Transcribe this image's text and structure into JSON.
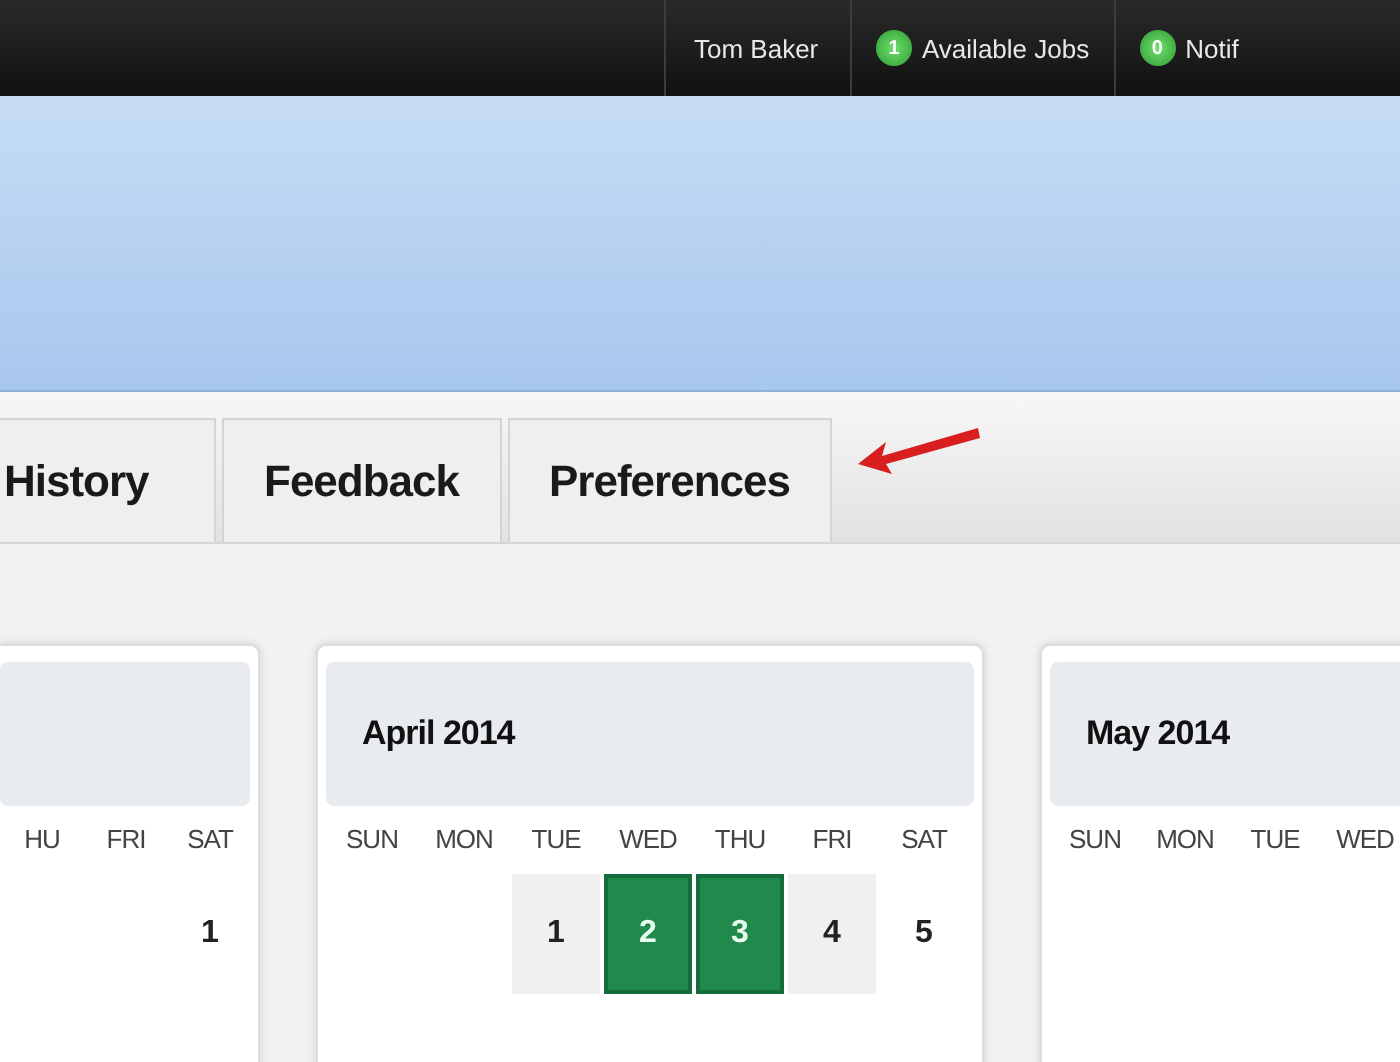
{
  "top_bar": {
    "user": "Tom Baker",
    "badges": [
      {
        "count": "1",
        "label": "Available Jobs"
      },
      {
        "count": "0",
        "label": "Notif"
      }
    ]
  },
  "tabs": [
    {
      "label": "History",
      "selected": false
    },
    {
      "label": "Feedback",
      "selected": false
    },
    {
      "label": "Preferences",
      "selected": false
    }
  ],
  "calendars": [
    {
      "weekdays": [
        "HU",
        "FRI",
        "SAT"
      ],
      "dates": [
        {
          "kind": "empty"
        },
        {
          "kind": "empty"
        },
        {
          "kind": "day",
          "label": "1",
          "available": false,
          "selected": false
        }
      ]
    },
    {
      "title": "April 2014",
      "weekdays": [
        "SUN",
        "MON",
        "TUE",
        "WED",
        "THU",
        "FRI",
        "SAT"
      ],
      "dates": [
        {
          "kind": "empty"
        },
        {
          "kind": "empty"
        },
        {
          "kind": "day",
          "label": "1",
          "available": true,
          "selected": false
        },
        {
          "kind": "day",
          "label": "2",
          "available": true,
          "selected": true
        },
        {
          "kind": "day",
          "label": "3",
          "available": true,
          "selected": true
        },
        {
          "kind": "day",
          "label": "4",
          "available": true,
          "selected": false
        },
        {
          "kind": "day",
          "label": "5",
          "available": false,
          "selected": false
        }
      ]
    },
    {
      "title": "May 2014",
      "weekdays": [
        "SUN",
        "MON",
        "TUE",
        "WED"
      ]
    }
  ]
}
